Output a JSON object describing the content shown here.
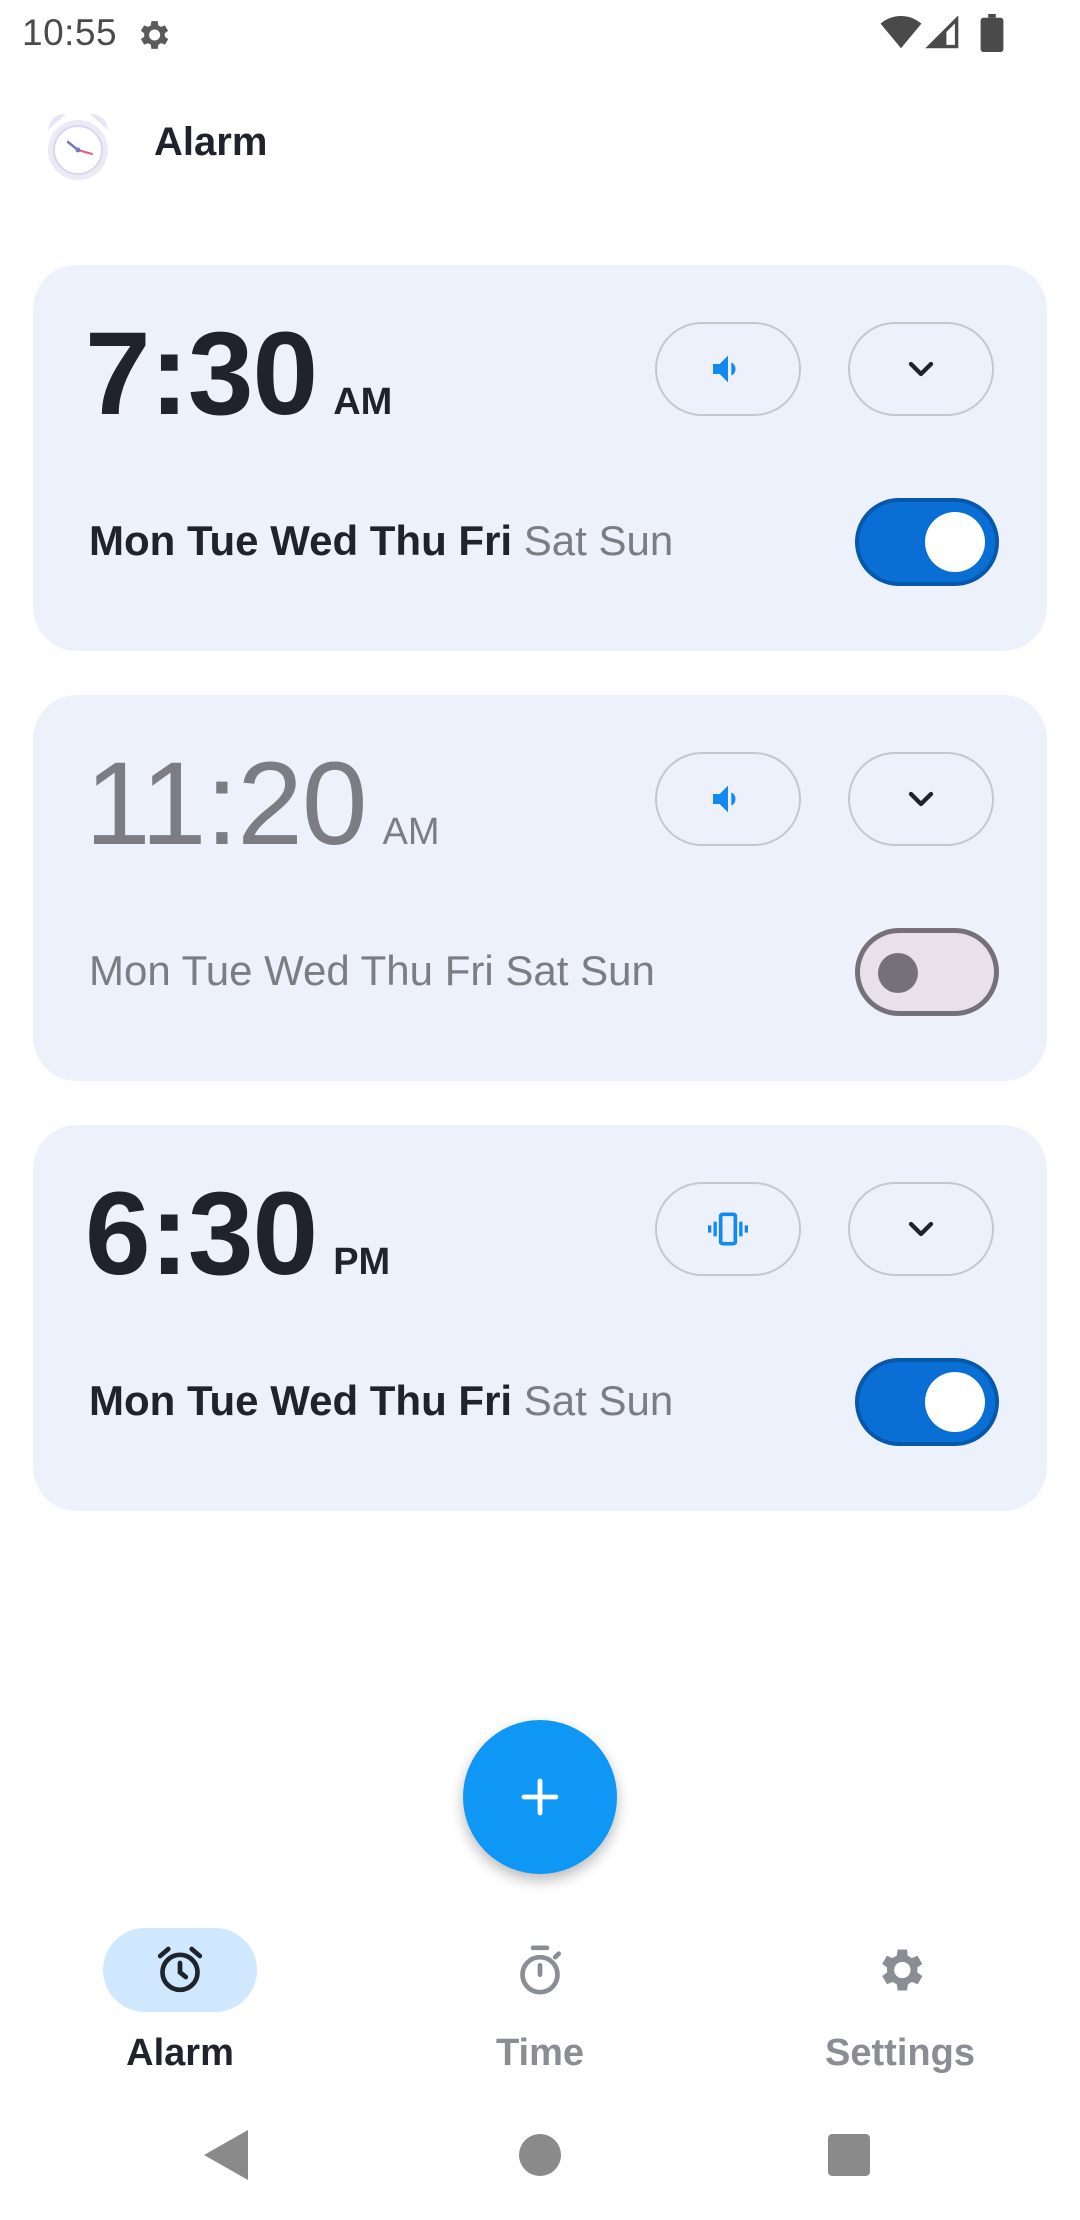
{
  "status_bar": {
    "time": "10:55",
    "icons": [
      "settings-gear-icon",
      "wifi-icon",
      "cell-signal-icon",
      "battery-icon"
    ]
  },
  "app_bar": {
    "title": "Alarm",
    "logo_icon": "alarm-clock-logo"
  },
  "alarms": [
    {
      "time": "7:30",
      "period": "AM",
      "enabled": true,
      "alert_mode_icon": "volume-icon",
      "expand_icon": "chevron-down-icon",
      "days": [
        {
          "label": "Mon",
          "active": true
        },
        {
          "label": "Tue",
          "active": true
        },
        {
          "label": "Wed",
          "active": true
        },
        {
          "label": "Thu",
          "active": true
        },
        {
          "label": "Fri",
          "active": true
        },
        {
          "label": "Sat",
          "active": false
        },
        {
          "label": "Sun",
          "active": false
        }
      ]
    },
    {
      "time": "11:20",
      "period": "AM",
      "enabled": false,
      "alert_mode_icon": "volume-icon",
      "expand_icon": "chevron-down-icon",
      "days": [
        {
          "label": "Mon",
          "active": false
        },
        {
          "label": "Tue",
          "active": false
        },
        {
          "label": "Wed",
          "active": false
        },
        {
          "label": "Thu",
          "active": false
        },
        {
          "label": "Fri",
          "active": false
        },
        {
          "label": "Sat",
          "active": false
        },
        {
          "label": "Sun",
          "active": false
        }
      ]
    },
    {
      "time": "6:30",
      "period": "PM",
      "enabled": true,
      "alert_mode_icon": "vibrate-icon",
      "expand_icon": "chevron-down-icon",
      "days": [
        {
          "label": "Mon",
          "active": true
        },
        {
          "label": "Tue",
          "active": true
        },
        {
          "label": "Wed",
          "active": true
        },
        {
          "label": "Thu",
          "active": true
        },
        {
          "label": "Fri",
          "active": true
        },
        {
          "label": "Sat",
          "active": false
        },
        {
          "label": "Sun",
          "active": false
        }
      ]
    }
  ],
  "fab": {
    "icon": "plus-icon"
  },
  "bottom_nav": {
    "items": [
      {
        "label": "Alarm",
        "icon": "alarm-clock-icon",
        "active": true
      },
      {
        "label": "Time",
        "icon": "stopwatch-icon",
        "active": false
      },
      {
        "label": "Settings",
        "icon": "gear-icon",
        "active": false
      }
    ]
  },
  "system_nav": {
    "icons": [
      "back-icon",
      "home-icon",
      "recents-icon"
    ]
  },
  "colors": {
    "accent": "#0f97f5",
    "toggle_on": "#0a6fd4",
    "card_background": "#ecf1fc",
    "nav_indicator": "#cfe8fd"
  }
}
